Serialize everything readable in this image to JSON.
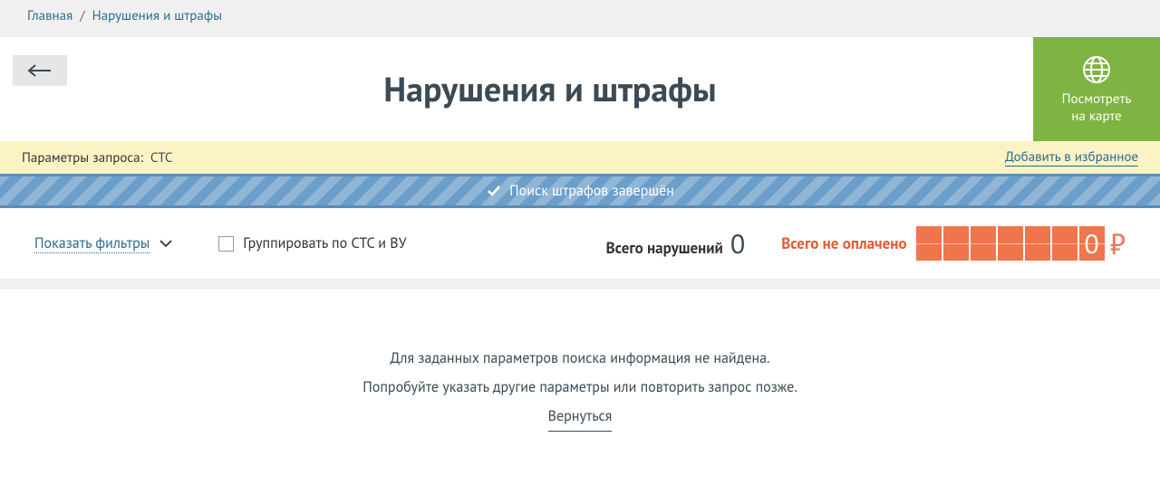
{
  "breadcrumb": {
    "home": "Главная",
    "current": "Нарушения и штрафы"
  },
  "header": {
    "title": "Нарушения и штрафы",
    "map_button_line1": "Посмотреть",
    "map_button_line2": "на карте"
  },
  "query": {
    "label": "Параметры запроса:",
    "value": "СТС",
    "favorite": "Добавить в избранное"
  },
  "progress": {
    "text": "Поиск штрафов завершён"
  },
  "filters": {
    "show": "Показать фильтры",
    "group_label": "Группировать по СТС и ВУ",
    "total_label": "Всего нарушений",
    "total_count": "0",
    "unpaid_label": "Всего не оплачено",
    "unpaid_zero": "0",
    "ruble": "₽"
  },
  "empty": {
    "line1": "Для заданных параметров поиска информация не найдена.",
    "line2": "Попробуйте указать другие параметры или повторить запрос позже.",
    "return": "Вернуться"
  }
}
